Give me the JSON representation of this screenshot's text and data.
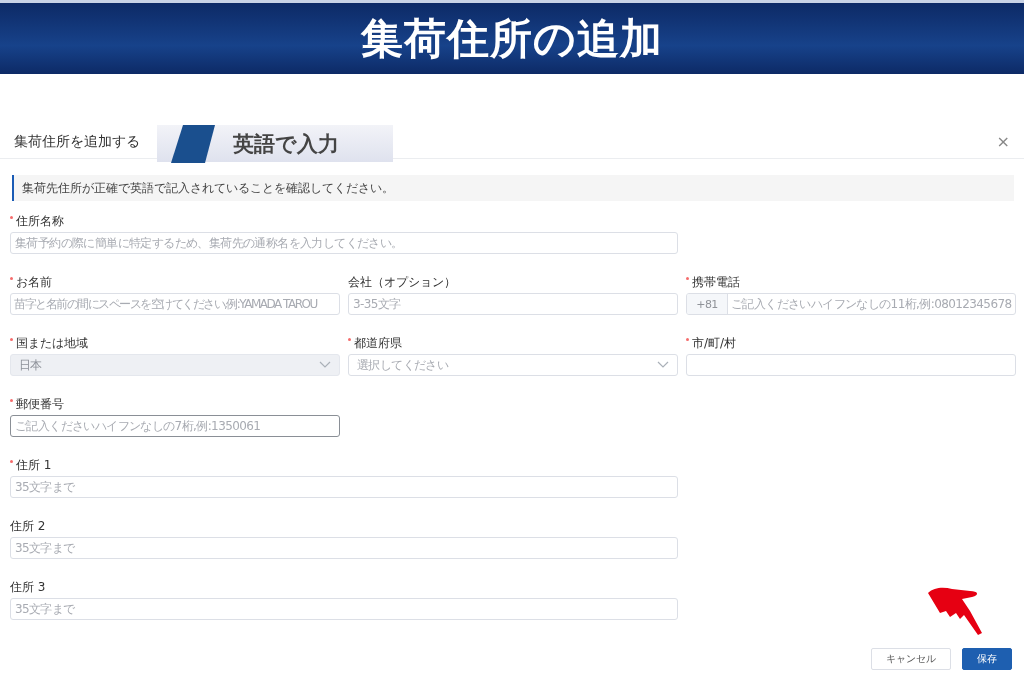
{
  "banner": {
    "title": "集荷住所の追加"
  },
  "dialog": {
    "title": "集荷住所を追加する",
    "annotation": "英語で入力",
    "close": "×"
  },
  "notice": "集荷先住所が正確で英語で記入されていることを確認してください。",
  "rows": [
    [
      {
        "kind": "text",
        "label": "住所名称",
        "required": true,
        "placeholder": "集荷予約の際に簡単に特定するため、集荷先の通称名を入力してください。"
      }
    ],
    [
      {
        "kind": "text",
        "label": "お名前",
        "required": true,
        "placeholder": "苗字と名前の間にスペースを空けてください,例:YAMADA TAROU"
      },
      {
        "kind": "text",
        "label": "会社（オプション）",
        "required": false,
        "placeholder": "3-35文字"
      },
      {
        "kind": "phone",
        "label": "携帯電話",
        "required": true,
        "prefix": "+81",
        "placeholder": "ご記入くださいハイフンなしの11桁,例:08012345678"
      }
    ],
    [
      {
        "kind": "select",
        "label": "国または地域",
        "required": true,
        "value": "日本",
        "disabled": true
      },
      {
        "kind": "select",
        "label": "都道府県",
        "required": true,
        "placeholder": "選択してください",
        "disabled": false
      },
      {
        "kind": "text",
        "label": "市/町/村",
        "required": true
      }
    ],
    [
      {
        "kind": "text",
        "label": "郵便番号",
        "required": true,
        "focused": true,
        "placeholder": "ご記入くださいハイフンなしの7桁,例:1350061"
      }
    ],
    [
      {
        "kind": "text",
        "label": "住所 1",
        "required": true,
        "placeholder": "35文字まで"
      }
    ],
    [
      {
        "kind": "text",
        "label": "住所 2",
        "required": false,
        "placeholder": "35文字まで"
      }
    ],
    [
      {
        "kind": "text",
        "label": "住所 3",
        "required": false,
        "placeholder": "35文字まで"
      }
    ]
  ],
  "buttons": [
    {
      "label": "キャンセル",
      "primary": false
    },
    {
      "label": "保存",
      "primary": true
    }
  ]
}
